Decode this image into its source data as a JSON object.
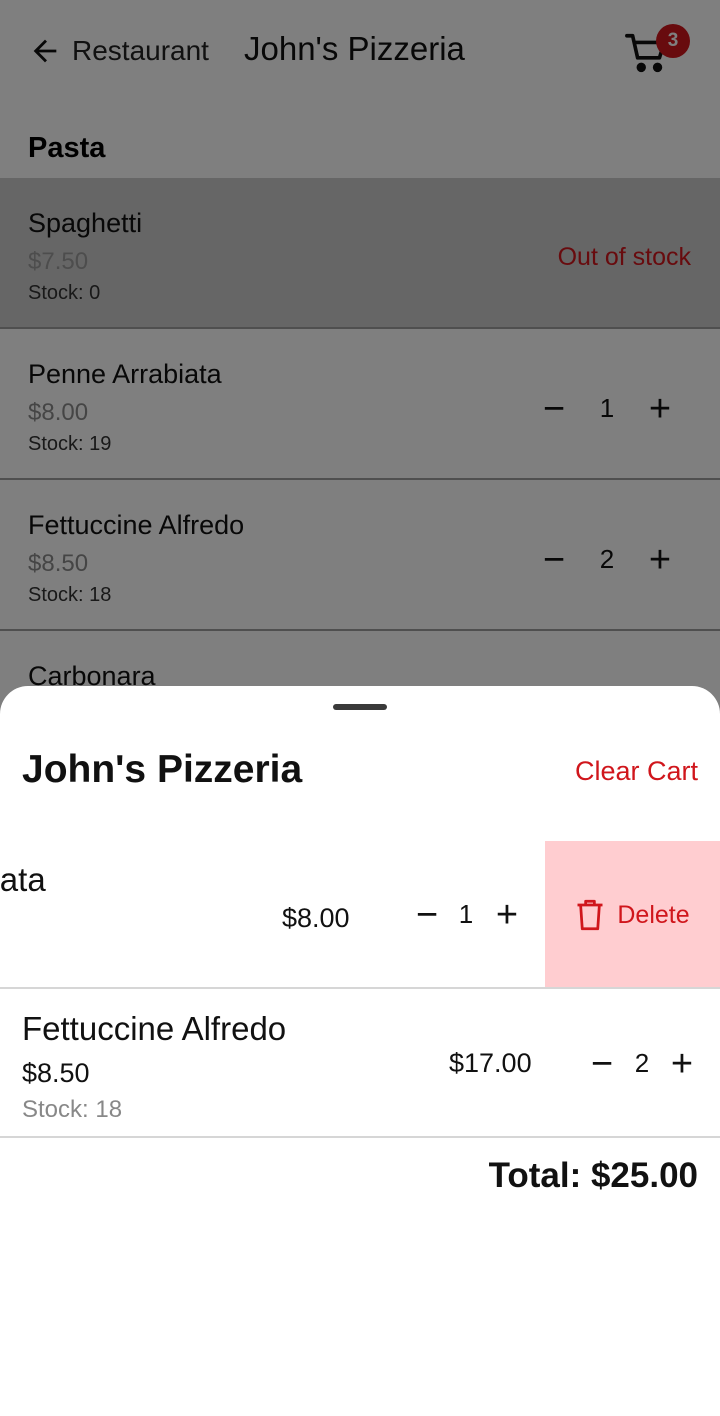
{
  "appbar": {
    "back_label": "Restaurant",
    "title": "John's Pizzeria",
    "cart_count": "3"
  },
  "menu": {
    "section_title": "Pasta",
    "items": [
      {
        "name": "Spaghetti",
        "price": "$7.50",
        "stock": "Stock: 0",
        "status": "Out of stock"
      },
      {
        "name": "Penne Arrabiata",
        "price": "$8.00",
        "stock": "Stock: 19",
        "qty": "1"
      },
      {
        "name": "Fettuccine Alfredo",
        "price": "$8.50",
        "stock": "Stock: 18",
        "qty": "2"
      },
      {
        "name": "Carbonara"
      }
    ]
  },
  "sheet": {
    "title": "John's Pizzeria",
    "clear_label": "Clear Cart",
    "items": [
      {
        "name": "Penne Arrabiata",
        "line_total": "$8.00",
        "qty": "1",
        "delete_label": "Delete"
      },
      {
        "name": "Fettuccine Alfredo",
        "price": "$8.50",
        "stock": "Stock: 18",
        "line_total": "$17.00",
        "qty": "2"
      }
    ],
    "total": "Total: $25.00"
  },
  "stepper": {
    "minus": "−",
    "plus": "+"
  },
  "colors": {
    "accent": "#d0161c",
    "delete_bg": "#ffcdd0",
    "scrim": "rgba(0,0,0,0.5)"
  }
}
